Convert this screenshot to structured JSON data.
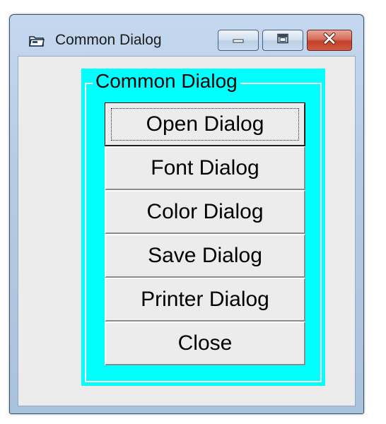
{
  "window": {
    "title": "Common Dialog",
    "controls": {
      "minimize": "minimize",
      "maximize": "maximize",
      "close": "close"
    }
  },
  "group": {
    "caption": "Common Dialog",
    "background_color": "#00ffff"
  },
  "buttons": {
    "open": "Open Dialog",
    "font": "Font Dialog",
    "color": "Color Dialog",
    "save": "Save Dialog",
    "printer": "Printer Dialog",
    "close": "Close"
  },
  "icons": {
    "app": "folder-icon",
    "minimize": "minimize-icon",
    "maximize": "maximize-icon",
    "close": "close-icon"
  },
  "colors": {
    "close_button": "#c2402b",
    "frame": "#00ffff"
  }
}
